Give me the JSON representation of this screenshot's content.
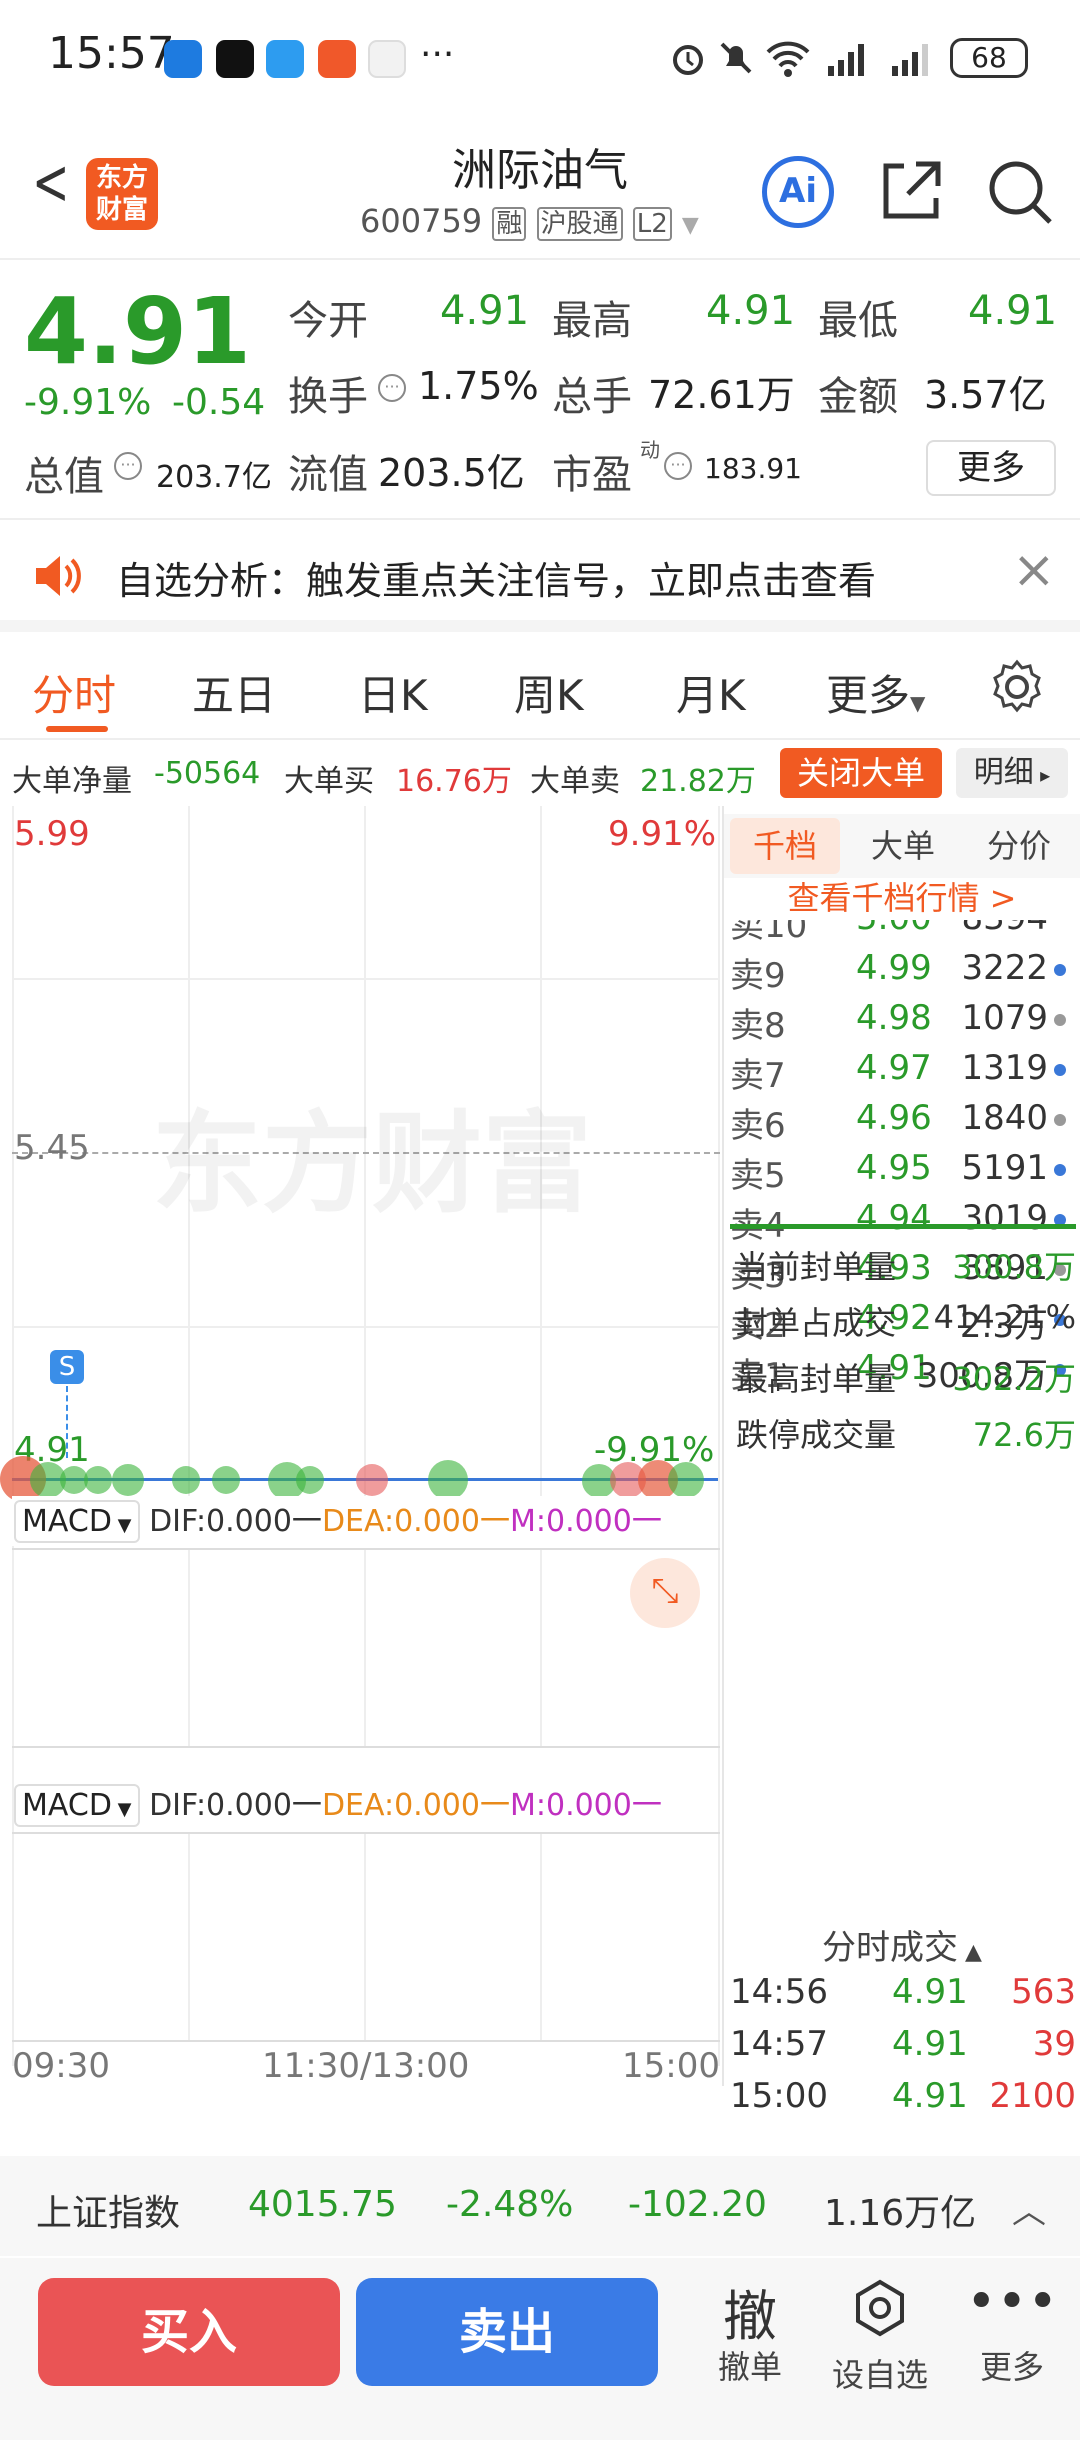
{
  "status_bar": {
    "time": "15:57",
    "more": "···",
    "battery": "68"
  },
  "header": {
    "back": "<",
    "logo_line1": "东方",
    "logo_line2": "财富",
    "title": "洲际油气",
    "code": "600759",
    "tag_margin": "融",
    "tag_connect": "沪股通",
    "tag_level": "L2",
    "ai": "Ai"
  },
  "quote": {
    "price": "4.91",
    "change_pct": "-9.91%",
    "change": "-0.54",
    "open_label": "今开",
    "open": "4.91",
    "high_label": "最高",
    "high": "4.91",
    "low_label": "最低",
    "low": "4.91",
    "turnover_label": "换手",
    "turnover": "1.75%",
    "volume_label": "总手",
    "volume": "72.61万",
    "amount_label": "金额",
    "amount": "3.57亿",
    "mktcap_label": "总值",
    "mktcap": "203.7亿",
    "float_label": "流值",
    "float_cap": "203.5亿",
    "pe_label": "市盈",
    "pe_sup": "动",
    "pe": "183.91",
    "more": "更多"
  },
  "banner": {
    "text": "自选分析：触发重点关注信号，立即点击查看",
    "close": "×"
  },
  "tabs": [
    "分时",
    "五日",
    "日K",
    "周K",
    "月K"
  ],
  "tab_more": "更多",
  "big_order": {
    "net_label": "大单净量",
    "net": "-50564",
    "buy_label": "大单买",
    "buy": "16.76万",
    "sell_label": "大单卖",
    "sell": "21.82万",
    "close_btn": "关闭大单",
    "detail": "明细"
  },
  "chart": {
    "high": "5.99",
    "high_pct": "9.91%",
    "mid": "5.45",
    "last": "4.91",
    "last_pct": "-9.91%",
    "watermark": "东方财富",
    "marker": "S",
    "times": [
      "09:30",
      "11:30/13:00",
      "15:00"
    ]
  },
  "macd1": {
    "label": "MACD",
    "dif": "DIF:0.000一",
    "dea": "DEA:0.000一",
    "m": "M:0.000一"
  },
  "macd2": {
    "label": "MACD",
    "dif": "DIF:0.000一",
    "dea": "DEA:0.000一",
    "m": "M:0.000一"
  },
  "right_tabs": [
    "千档",
    "大单",
    "分价"
  ],
  "right_link": "查看千档行情 >",
  "orderbook": [
    {
      "label": "卖9",
      "price": "4.99",
      "vol": "3222",
      "dot": "#3a78d8"
    },
    {
      "label": "卖8",
      "price": "4.98",
      "vol": "1079",
      "dot": "#999999"
    },
    {
      "label": "卖7",
      "price": "4.97",
      "vol": "1319",
      "dot": "#3a78d8"
    },
    {
      "label": "卖6",
      "price": "4.96",
      "vol": "1840",
      "dot": "#999999"
    },
    {
      "label": "卖5",
      "price": "4.95",
      "vol": "5191",
      "dot": "#3a78d8"
    },
    {
      "label": "卖4",
      "price": "4.94",
      "vol": "3019",
      "dot": "#3a78d8"
    },
    {
      "label": "卖3",
      "price": "4.93",
      "vol": "3891",
      "dot": "#999999"
    },
    {
      "label": "卖2",
      "price": "4.92",
      "vol": "2.3万",
      "dot": "#3a78d8"
    },
    {
      "label": "卖1",
      "price": "4.91",
      "vol": "300.8万",
      "dot": "#3a78d8"
    }
  ],
  "ob_partial": {
    "label": "卖10",
    "price": "5.00",
    "vol": "8394"
  },
  "seal": [
    {
      "label": "当前封单量",
      "value": "300.8万",
      "color": "#2a9a2a"
    },
    {
      "label": "封单占成交",
      "value": "414.21%",
      "color": "#333333"
    },
    {
      "label": "最高封单量",
      "value": "302.2万",
      "color": "#2a9a2a"
    },
    {
      "label": "跌停成交量",
      "value": "72.6万",
      "color": "#2a9a2a"
    }
  ],
  "trades_title": "分时成交",
  "trades": [
    {
      "time": "14:56",
      "price": "4.91",
      "vol": "563"
    },
    {
      "time": "14:57",
      "price": "4.91",
      "vol": "39"
    },
    {
      "time": "15:00",
      "price": "4.91",
      "vol": "2100"
    }
  ],
  "index": {
    "name": "上证指数",
    "value": "4015.75",
    "pct": "-2.48%",
    "change": "-102.20",
    "amount": "1.16万亿"
  },
  "actions": {
    "buy": "买入",
    "sell": "卖出",
    "cancel_icon": "撤",
    "cancel": "撤单",
    "watch": "设自选",
    "more": "更多"
  }
}
